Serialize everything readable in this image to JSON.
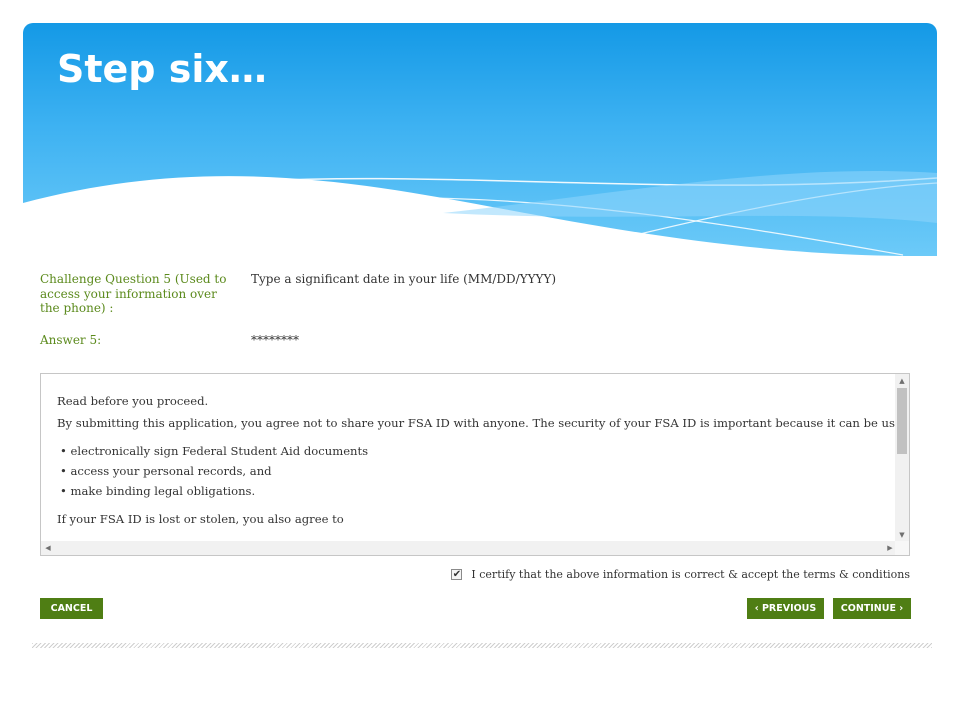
{
  "slide": {
    "title": "Step six…"
  },
  "form": {
    "challenge_question_label": "Challenge Question 5 (Used to access your information over the phone) :",
    "challenge_question_value": "Type a significant date in your life (MM/DD/YYYY)",
    "answer_label": "Answer 5:",
    "answer_value": "********"
  },
  "terms": {
    "heading": "Read before you proceed.",
    "intro": "By submitting this application, you agree not to share your FSA ID with anyone. The security of your FSA ID is important because it can be used to",
    "bullets": [
      "• electronically sign Federal Student Aid documents",
      "• access your personal records, and",
      "• make binding legal obligations."
    ],
    "lost_text": "If your FSA ID is lost or stolen, you also agree to"
  },
  "certify": {
    "checked": true,
    "check_mark": "✔",
    "label": "I certify that the above information is correct & accept the terms & conditions"
  },
  "buttons": {
    "cancel": "CANCEL",
    "previous": "‹ PREVIOUS",
    "continue": "CONTINUE ›"
  },
  "scrollbar_arrows": {
    "up": "▲",
    "down": "▼",
    "left": "◀",
    "right": "▶"
  },
  "colors": {
    "header_blue": "#1499e6",
    "label_green": "#5b8a1c",
    "button_green": "#4f7e14"
  }
}
